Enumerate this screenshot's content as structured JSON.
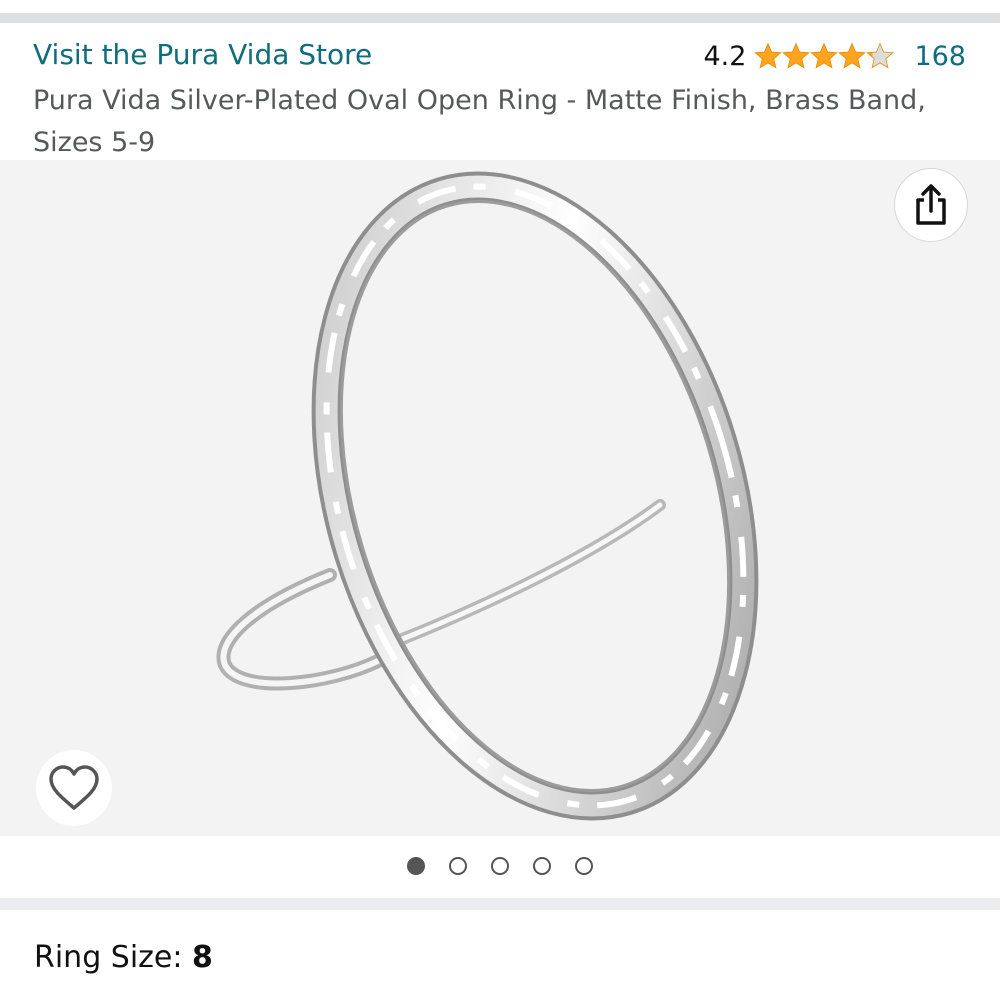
{
  "store": {
    "link_text": "Visit the Pura Vida Store"
  },
  "rating": {
    "value": "4.2",
    "stars": 4.2,
    "max_stars": 5,
    "review_count": "168",
    "star_color": "#ffa41c",
    "empty_star_color": "#dddddd"
  },
  "product": {
    "title": "Pura Vida Silver-Plated Oval Open Ring - Matte Finish, Brass Band, Sizes 5-9"
  },
  "gallery": {
    "image_count": 5,
    "active_index": 0,
    "share_icon": "share-icon",
    "favorite_icon": "heart-outline-icon"
  },
  "variation": {
    "label": "Ring Size: ",
    "value": "8"
  },
  "colors": {
    "link": "#0f6e7e",
    "text_secondary": "#565959",
    "gallery_background": "#f3f3f3"
  }
}
